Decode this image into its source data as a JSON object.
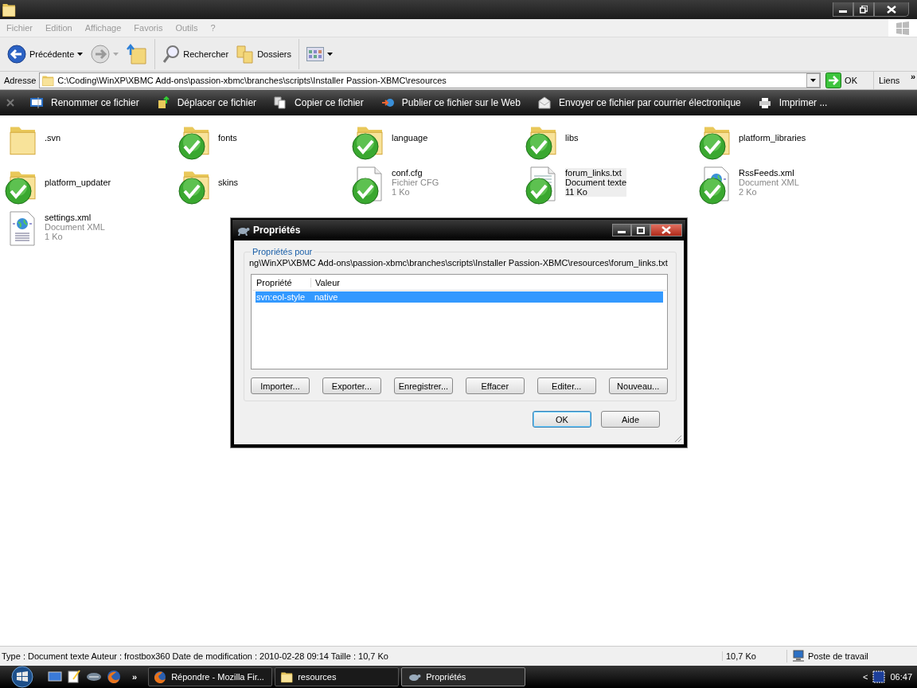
{
  "menu": [
    "Fichier",
    "Edition",
    "Affichage",
    "Favoris",
    "Outils",
    "?"
  ],
  "toolbar": [
    {
      "kind": "back",
      "label": "Précédente"
    },
    {
      "kind": "forward"
    },
    {
      "kind": "up"
    },
    {
      "kind": "search",
      "label": "Rechercher"
    },
    {
      "kind": "folders",
      "label": "Dossiers"
    },
    {
      "kind": "views"
    }
  ],
  "address": {
    "label": "Adresse",
    "value": "C:\\Coding\\WinXP\\XBMC Add-ons\\passion-xbmc\\branches\\scripts\\Installer Passion-XBMC\\resources",
    "go": "OK",
    "links": "Liens",
    "links_more": "»"
  },
  "tasks": [
    {
      "kind": "rename",
      "label": "Renommer ce fichier"
    },
    {
      "kind": "move",
      "label": "Déplacer ce fichier"
    },
    {
      "kind": "copy",
      "label": "Copier ce fichier"
    },
    {
      "kind": "publish",
      "label": "Publier ce fichier sur le Web"
    },
    {
      "kind": "mail",
      "label": "Envoyer ce fichier par courrier électronique"
    },
    {
      "kind": "print",
      "label": "Imprimer ..."
    }
  ],
  "files": [
    {
      "name": ".svn",
      "kind": "folder",
      "versioned": false,
      "selected": false
    },
    {
      "name": "fonts",
      "kind": "folder",
      "versioned": true,
      "selected": false
    },
    {
      "name": "language",
      "kind": "folder",
      "versioned": true,
      "selected": false
    },
    {
      "name": "libs",
      "kind": "folder",
      "versioned": true,
      "selected": false
    },
    {
      "name": "platform_libraries",
      "kind": "folder",
      "versioned": true,
      "selected": false
    },
    {
      "name": "platform_updater",
      "kind": "folder",
      "versioned": true,
      "selected": false
    },
    {
      "name": "skins",
      "kind": "folder",
      "versioned": true,
      "selected": false
    },
    {
      "name": "conf.cfg",
      "kind": "file",
      "type": "Fichier CFG",
      "size": "1 Ko",
      "versioned": true,
      "selected": false
    },
    {
      "name": "forum_links.txt",
      "kind": "text",
      "type": "Document texte",
      "size": "11 Ko",
      "versioned": true,
      "selected": true
    },
    {
      "name": "RssFeeds.xml",
      "kind": "xml",
      "type": "Document XML",
      "size": "2 Ko",
      "versioned": true,
      "selected": false
    },
    {
      "name": "settings.xml",
      "kind": "xml",
      "type": "Document XML",
      "size": "1 Ko",
      "versioned": false,
      "selected": false
    }
  ],
  "dialog": {
    "title": "Propriétés",
    "group_label": "Propriétés pour",
    "path": "ng\\WinXP\\XBMC Add-ons\\passion-xbmc\\branches\\scripts\\Installer Passion-XBMC\\resources\\forum_links.txt",
    "columns": [
      "Propriété",
      "Valeur"
    ],
    "rows": [
      {
        "property": "svn:eol-style",
        "value": "native",
        "selected": true
      }
    ],
    "buttons": [
      "Importer...",
      "Exporter...",
      "Enregistrer...",
      "Effacer",
      "Editer...",
      "Nouveau..."
    ],
    "footer_buttons": [
      {
        "label": "OK",
        "default": true
      },
      {
        "label": "Aide",
        "default": false
      }
    ]
  },
  "status_bar": {
    "text": "Type : Document texte Auteur : frostbox360 Date de modification : 2010-02-28 09:14 Taille  : 10,7 Ko",
    "size": "10,7 Ko",
    "zone": "Poste de travail"
  },
  "taskbar": {
    "quick_launch_more": "»",
    "tasks": [
      {
        "kind": "browser",
        "label": "Répondre - Mozilla Fir...",
        "selected": false
      },
      {
        "kind": "folder",
        "label": "resources",
        "selected": false
      },
      {
        "kind": "turtle",
        "label": "Propriétés",
        "selected": true
      }
    ],
    "tray_expand": "<",
    "clock": "06:47"
  }
}
